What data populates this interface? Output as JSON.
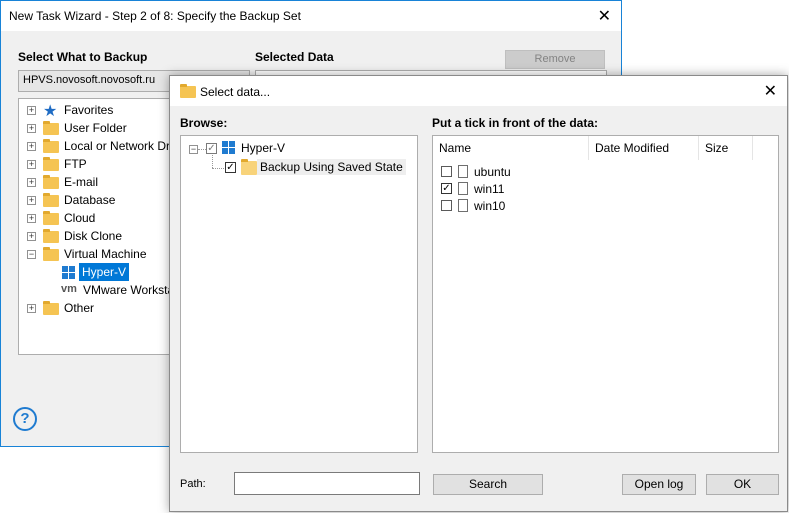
{
  "wizard": {
    "title": "New Task Wizard - Step 2 of 8: Specify the Backup Set",
    "select_label": "Select What to Backup",
    "selected_label": "Selected Data",
    "remove_label": "Remove",
    "computer": "HPVS.novosoft.novosoft.ru",
    "tree": [
      {
        "label": "Favorites",
        "icon": "star-icon"
      },
      {
        "label": "User Folder",
        "icon": "folder-icon"
      },
      {
        "label": "Local or Network Dri",
        "icon": "folder-icon"
      },
      {
        "label": "FTP",
        "icon": "folder-icon"
      },
      {
        "label": "E-mail",
        "icon": "folder-icon"
      },
      {
        "label": "Database",
        "icon": "folder-icon"
      },
      {
        "label": "Cloud",
        "icon": "folder-icon"
      },
      {
        "label": "Disk Clone",
        "icon": "folder-icon"
      },
      {
        "label": "Virtual Machine",
        "icon": "folder-icon"
      },
      {
        "label": "Hyper-V",
        "icon": "windows-icon",
        "selected": true
      },
      {
        "label": "VMware Worksta",
        "icon": "vmware-icon",
        "icon_text": "vm"
      },
      {
        "label": "Other",
        "icon": "folder-icon"
      }
    ],
    "help": "?"
  },
  "dialog": {
    "title": "Select data...",
    "browse_label": "Browse:",
    "tick_label": "Put a tick in front of the data:",
    "browse_tree": [
      {
        "label": "Hyper-V",
        "checked": "partial"
      },
      {
        "label": "Backup Using Saved State",
        "checked": "checked"
      }
    ],
    "columns": [
      "Name",
      "Date Modified",
      "Size"
    ],
    "files": [
      {
        "name": "ubuntu",
        "checked": false
      },
      {
        "name": "win11",
        "checked": true
      },
      {
        "name": "win10",
        "checked": false
      }
    ],
    "path_label": "Path:",
    "path_value": "",
    "search_label": "Search",
    "openlog_label": "Open log",
    "ok_label": "OK"
  },
  "colors": {
    "accent": "#1f7bd0",
    "selection": "#0078d7",
    "folder": "#f5c453"
  }
}
